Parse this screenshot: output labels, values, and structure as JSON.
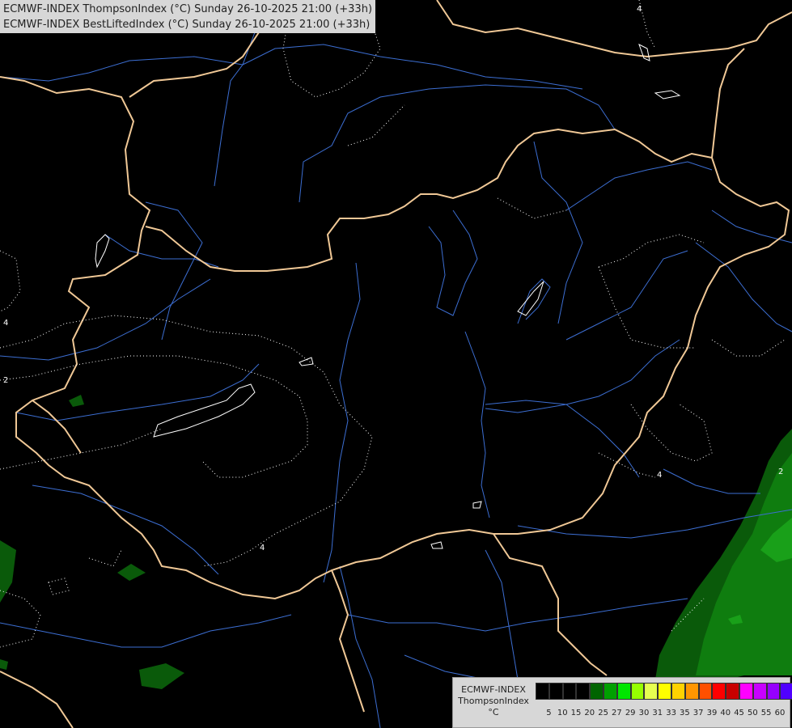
{
  "header": {
    "line1": "ECMWF-INDEX ThompsonIndex (°C) Sunday 26-10-2025 21:00 (+33h)",
    "line2": "ECMWF-INDEX BestLiftedIndex (°C) Sunday 26-10-2025 21:00 (+33h)"
  },
  "contour_labels": [
    "4",
    "4",
    "2",
    "4",
    "4",
    "2"
  ],
  "legend": {
    "title_line1": "ECMWF-INDEX",
    "title_line2": "ThompsonIndex",
    "unit": "°C",
    "colors": [
      "#000000",
      "#000000",
      "#000000",
      "#000000",
      "#006400",
      "#00a000",
      "#00e600",
      "#96ff00",
      "#e6ff50",
      "#ffff00",
      "#ffd200",
      "#ff9600",
      "#ff5000",
      "#ff0000",
      "#c80000",
      "#ff00ff",
      "#c800ff",
      "#9600ff",
      "#5000ff",
      "#0000ff"
    ],
    "ticks": [
      "5",
      "10",
      "15",
      "20",
      "25",
      "27",
      "29",
      "30",
      "31",
      "33",
      "35",
      "37",
      "39",
      "40",
      "45",
      "50",
      "55",
      "60"
    ]
  },
  "colors": {
    "border": "#f0c896",
    "river": "#3c6ed2",
    "contour": "#ffffff",
    "green_dark": "#0a5a0a",
    "green_mid": "#0f7d0f",
    "green_light": "#19a019"
  }
}
